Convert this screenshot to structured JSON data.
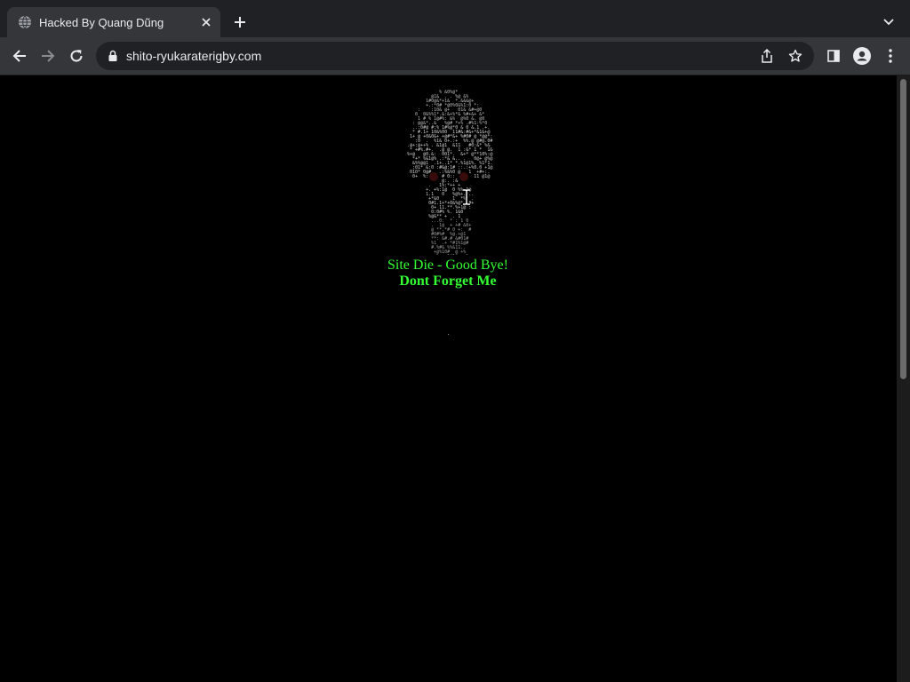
{
  "browser": {
    "tab": {
      "title": "Hacked By Quang Dũng",
      "favicon": "globe-icon"
    },
    "address_bar": {
      "url": "shito-ryukaraterigby.com"
    },
    "colors": {
      "chrome_dark": "#202124",
      "chrome": "#35363a",
      "text": "#e8eaed"
    }
  },
  "page": {
    "background": "#000000",
    "accent": "#33ff33",
    "line1": "Site Die - Good Bye!",
    "line2": "Dont Forget Me",
    "image": "ascii-skull-art"
  }
}
